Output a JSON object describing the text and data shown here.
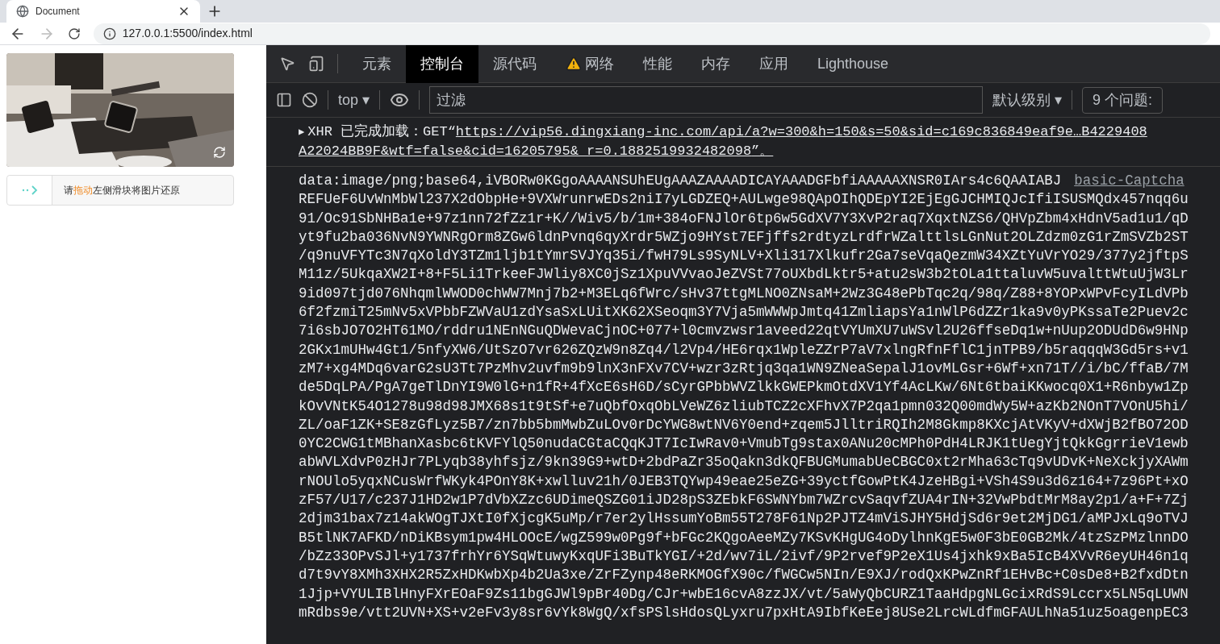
{
  "browser": {
    "tab": {
      "title": "Document"
    },
    "nav": {
      "back_disabled": false,
      "forward_disabled": true
    },
    "address": "127.0.0.1:5500/index.html"
  },
  "page": {
    "captcha": {
      "hint": {
        "before": "请",
        "highlight": "拖动",
        "after": "左侧滑块将图片还原"
      }
    }
  },
  "devtools": {
    "tabs": [
      {
        "label": "元素",
        "selected": false,
        "warning": false
      },
      {
        "label": "控制台",
        "selected": true,
        "warning": false
      },
      {
        "label": "源代码",
        "selected": false,
        "warning": false
      },
      {
        "label": "网络",
        "selected": false,
        "warning": true
      },
      {
        "label": "性能",
        "selected": false,
        "warning": false
      },
      {
        "label": "内存",
        "selected": false,
        "warning": false
      },
      {
        "label": "应用",
        "selected": false,
        "warning": false
      },
      {
        "label": "Lighthouse",
        "selected": false,
        "warning": false
      }
    ],
    "toolbar": {
      "context": "top",
      "caret": "▾",
      "level_caret": "▾",
      "filter_placeholder": "过滤",
      "level": "默认级别",
      "issues": "9 个问题:"
    },
    "xhr": {
      "arrow": "▶",
      "prefix": "XHR 已完成加载：GET“",
      "url_line_1": "https://vip56.dingxiang-inc.com/api/a?w=300&h=150&s=50&sid=c169c836849eaf9e…B4229408",
      "url_line_2": "A22024BB9F&wtf=false&cid=16205795&_r=0.1882519932482098",
      "suffix": "”。"
    },
    "log": {
      "source": "basic-Captcha",
      "lines": [
        "data:image/png;base64,iVBORw0KGgoAAAANSUhEUgAAAZAAAADICAYAAADGFbfiAAAAAXNSR0IArs4c6QAAIABJ",
        "REFUeF6UvWnMbWl237X2dObpHe+9VXWrunrwEDs2niI7yLGDZEQ+AULwge98QApOIhQDEpYI2EjEgGJCHMIQJcIfiISUSMQdx457nqq6u",
        "91/Oc91SbNHBa1e+97z1nn72fZz1r+K//Wiv5/b/1m+384oFNJlOr6tp6w5GdXV7Y3XvP2raq7XqxtNZS6/QHVpZbm4xHdnV5ad1u1/qD",
        "yt9fu2ba036NvN9YWNRgOrm8ZGw6ldnPvnq6qyXrdr5WZjo9HYst7EFjffs2rdtyzLrdfrWZalttlsLGnNut2OLZdzm0zG1rZmSVZb2ST",
        "/q9nuVFYTc3N7qXoldY3TZm1ljb1tYmrSVJYq35i/fwH79Ls9SyNLV+Xli317Xlkufr2Ga7seVqaQezmW34XZtYuVrYO29/377y2jftpS",
        "M11z/5UkqaXW2I+8+F5Li1TrkeeFJWliy8XC0jSz1XpuVVvaoJeZVSt77oUXbdLktr5+atu2sW3b2tOLa1ttaluvW5uvalttWtuUjW3Lr",
        "9id097tjd076NhqmlWWOD0chWW7Mnj7b2+M3ELq6fWrc/sHv37ttgMLNO0ZNsaM+2Wz3G48ePbTqc2q/98q/Z88+8YOPxWPvFcyILdVPb",
        "6f2fzmiT25mNv5xVPbbFZWVaU1zdYsaSxLUitXK62XSeoqm3Y7Vja5mWWWpJmtq41ZmliapsYa1nWlP6dZZr1ka9v0yPKssaTe2Puev2c",
        "7i6sbJO7O2HT61MO/rddru1NEnNGuQDWevaCjnOC+077+l0cmvzwsr1aveed22qtVYUmXU7uWSvl2U26ffseDq1w+nUup2ODUdD6w9HNp",
        "2GKx1mUHw4Gt1/5nfyXW6/UtSzO7vr626ZQzW9n8Zq4/l2Vp4/HE6rqx1WpleZZrP7aV7xlngRfnFflC1jnTPB9/b5raqqqW3Gd5rs+v1",
        "zM7+xg4MDq6varG2sU3Tt7PzMhv2uvfm9b9lnX3nFXv7CV+wzr3zRtjq3qa1WN9ZNeaSepalJ1ovMLGsr+6Wf+xn71T//i/bC/ffaB/7M",
        "de5DqLPA/PgA7geTlDnYI9W0lG+n1fR+4fXcE6sH6D/sCyrGPbbWVZlkkGWEPkmOtdXV1Yf4AcLKw/6Nt6tbaiKKwocq0X1+R6nbyw1Zp",
        "kOvVNtK54O1278u98d98JMX68s1t9tSf+e7uQbfOxqObLVeWZ6zliubTCZ2cXFhvX7P2qa1pmn032Q00mdWy5W+azKb2NOnT7VOnU5hi/",
        "ZL/oaF1ZK+SE8zGfLyz5B7/zn7bb5bmMwbZuLOv0rDcYWG8wtNV6Y0end+zqem5JlltriRQIh2M8Gkmp8KXcjAtVKyV+dXWjB2fBO72OD",
        "0YC2CWG1tMBhanXasbc6tKVFYlQ50nudaCGtaCQqKJT7IcIwRav0+VmubTg9stax0ANu20cMPh0PdH4LRJK1tUegYjtQkkGgrrieV1ewb",
        "abWVLXdvP0zHJr7PLyqb38yhfsjz/9kn39G9+wtD+2bdPaZr35oQakn3dkQFBUGMumabUeCBGC0xt2rMha63cTq9vUDvK+NeXckjyXAWm",
        "rNOUlo5yqxNCusWrfWKyk4POnY8K+xwlluv21h/0JEB3TQYwp49eae25eZG+39yctfGowPtK4JzeHBgi+VSh4S9u3d6z164+7z96Pt+xO",
        "zF57/U17/c237J1HD2w1P7dVbXZzc6UDimeQSZG01iJD28pS3ZEbkF6SWNYbm7WZrcvSaqvfZUA4rIN+32VwPbdtMrM8ay2p1/a+F+7Zj",
        "2djm31bax7z14akWOgTJXtI0fXjcgK5uMp/r7er2ylHssumYoBm55T278F61Np2PJTZ4mViSJHY5HdjSd6r9et2MjDG1/aMPJxLq9oTVJ",
        "B5tlNK7AFKD/nDiKBsym1pw4HLOOcE/wgZ599w0Pg9f+bFGc2KQgoAeeMZy7KSvKHgUG4oDylhnKgE5w0F3bE0GB2Mk/4tzSzPMzlnnDO",
        "/bZz33OPvSJl+y1737frhYr6YSqWtuwyKxqUFi3BuTkYGI/+2d/wv7iL/2ivf/9P2rvef9P2eX1Us4jxhk9xBa5IcB4XVvR6eyUH46n1q",
        "d7t9vY8XMh3XHX2R5ZxHDKwbXp4b2Ua3xe/ZrFZynp48eRKMOGfX90c/fWGCw5NIn/E9XJ/rodQxKPwZnRf1EHvBc+C0sDe8+B2fxdDtn",
        "1Jjp+VYULIBlHnyFXrEOaF9Zs11bgGJWl9pBr40Dg/CJr+wbE16cvA8zzJX/vt/5aWyQbCURZ1TaaHdpgNLGcixRdS9Lccrx5LN5qLUWN",
        "mRdbs9e/vtt2UVN+XS+v2eFv3y8sr6vYk8WgQ/xfsPSlsHdosQLyxru7pxHtA9IbfKeEej8USe2LrcWLdfmGFAULhNa51uz5oagenpEC3"
      ]
    }
  }
}
